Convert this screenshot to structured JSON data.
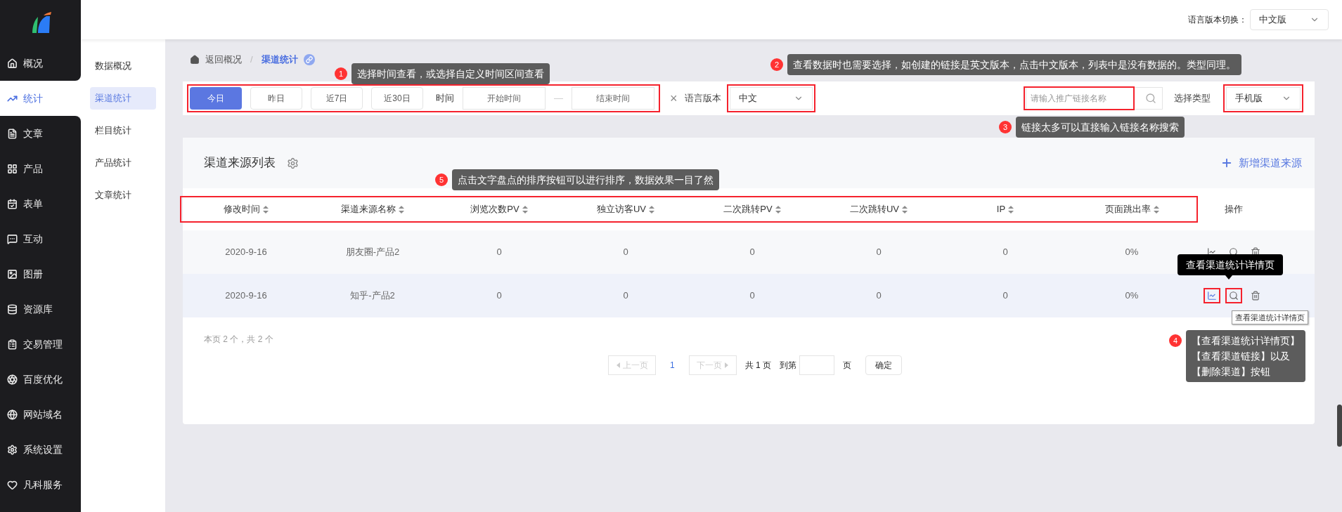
{
  "top_bar": {
    "language_label": "语言版本切换：",
    "language_value": "中文版"
  },
  "sidebar": {
    "items": [
      {
        "label": "概况",
        "selected": false
      },
      {
        "label": "统计",
        "selected": true
      },
      {
        "label": "文章",
        "selected": false
      },
      {
        "label": "产品",
        "selected": false
      },
      {
        "label": "表单",
        "selected": false
      },
      {
        "label": "互动",
        "selected": false
      },
      {
        "label": "图册",
        "selected": false
      },
      {
        "label": "资源库",
        "selected": false
      },
      {
        "label": "交易管理",
        "selected": false
      },
      {
        "label": "百度优化",
        "selected": false
      },
      {
        "label": "网站域名",
        "selected": false
      },
      {
        "label": "系统设置",
        "selected": false
      },
      {
        "label": "凡科服务",
        "selected": false
      }
    ]
  },
  "subnav": {
    "items": [
      {
        "label": "数据概况",
        "selected": false
      },
      {
        "label": "渠道统计",
        "selected": true
      },
      {
        "label": "栏目统计",
        "selected": false
      },
      {
        "label": "产品统计",
        "selected": false
      },
      {
        "label": "文章统计",
        "selected": false
      }
    ]
  },
  "breadcrumb": {
    "back": "返回概况",
    "separator": "/",
    "current": "渠道统计"
  },
  "date_filter": {
    "highlighted": true,
    "buttons": [
      {
        "label": "今日",
        "selected": true
      },
      {
        "label": "昨日",
        "selected": false
      },
      {
        "label": "近7日",
        "selected": false
      },
      {
        "label": "近30日",
        "selected": false
      }
    ],
    "time_label": "时间",
    "start_placeholder": "开始时间",
    "dash": "—",
    "end_placeholder": "结束时间",
    "clear": "×"
  },
  "language_filter": {
    "label": "语言版本",
    "value": "中文",
    "highlighted": true
  },
  "search": {
    "placeholder": "请输入推广链接名称",
    "highlighted": true
  },
  "type_filter": {
    "label": "选择类型",
    "value": "手机版",
    "highlighted": true
  },
  "table": {
    "title": "渠道来源列表",
    "add_button": "新增渠道来源",
    "header_highlighted": true,
    "columns": [
      {
        "label": "修改时间",
        "sortable": true
      },
      {
        "label": "渠道来源名称",
        "sortable": true
      },
      {
        "label": "浏览次数PV",
        "sortable": true
      },
      {
        "label": "独立访客UV",
        "sortable": true
      },
      {
        "label": "二次跳转PV",
        "sortable": true
      },
      {
        "label": "二次跳转UV",
        "sortable": true
      },
      {
        "label": "IP",
        "sortable": true
      },
      {
        "label": "页面跳出率",
        "sortable": true
      },
      {
        "label": "操作",
        "sortable": false
      }
    ],
    "rows": [
      {
        "cells": [
          "2020-9-16",
          "朋友圈-产品2",
          "0",
          "0",
          "0",
          "0",
          "0",
          "0%"
        ],
        "actions": [
          {
            "kind": "chart",
            "hovered": false,
            "highlighted": false
          },
          {
            "kind": "search",
            "hovered": false,
            "highlighted": false
          },
          {
            "kind": "delete",
            "hovered": false,
            "highlighted": false
          }
        ]
      },
      {
        "cells": [
          "2020-9-16",
          "知乎-产品2",
          "0",
          "0",
          "0",
          "0",
          "0",
          "0%"
        ],
        "actions": [
          {
            "kind": "chart",
            "hovered": true,
            "highlighted": true
          },
          {
            "kind": "search",
            "hovered": false,
            "highlighted": true
          },
          {
            "kind": "delete",
            "hovered": false,
            "highlighted": false
          }
        ]
      }
    ]
  },
  "pagination": {
    "summary": "本页 2 个，共 2 个",
    "prev": "上一页",
    "page": "1",
    "next": "下一页",
    "total": "共 1 页",
    "goto_label": "到第",
    "page_unit": "页",
    "confirm": "确定"
  },
  "tooltips": {
    "hover": "查看渠道统计详情页",
    "native": "查看渠道统计详情页"
  },
  "annotations": [
    {
      "number": "1",
      "text": "选择时间查看，或选择自定义时间区间查看"
    },
    {
      "number": "2",
      "text": "查看数据时也需要选择，如创建的链接是英文版本，点击中文版本，列表中是没有数据的。类型同理。"
    },
    {
      "number": "3",
      "text": "链接太多可以直接输入链接名称搜索"
    },
    {
      "number": "4",
      "lines": [
        "【查看渠道统计详情页】",
        "【查看渠道链接】以及",
        "【删除渠道】按钮"
      ]
    },
    {
      "number": "5",
      "text": "点击文字盘点的排序按钮可以进行排序，数据效果一目了然"
    }
  ]
}
